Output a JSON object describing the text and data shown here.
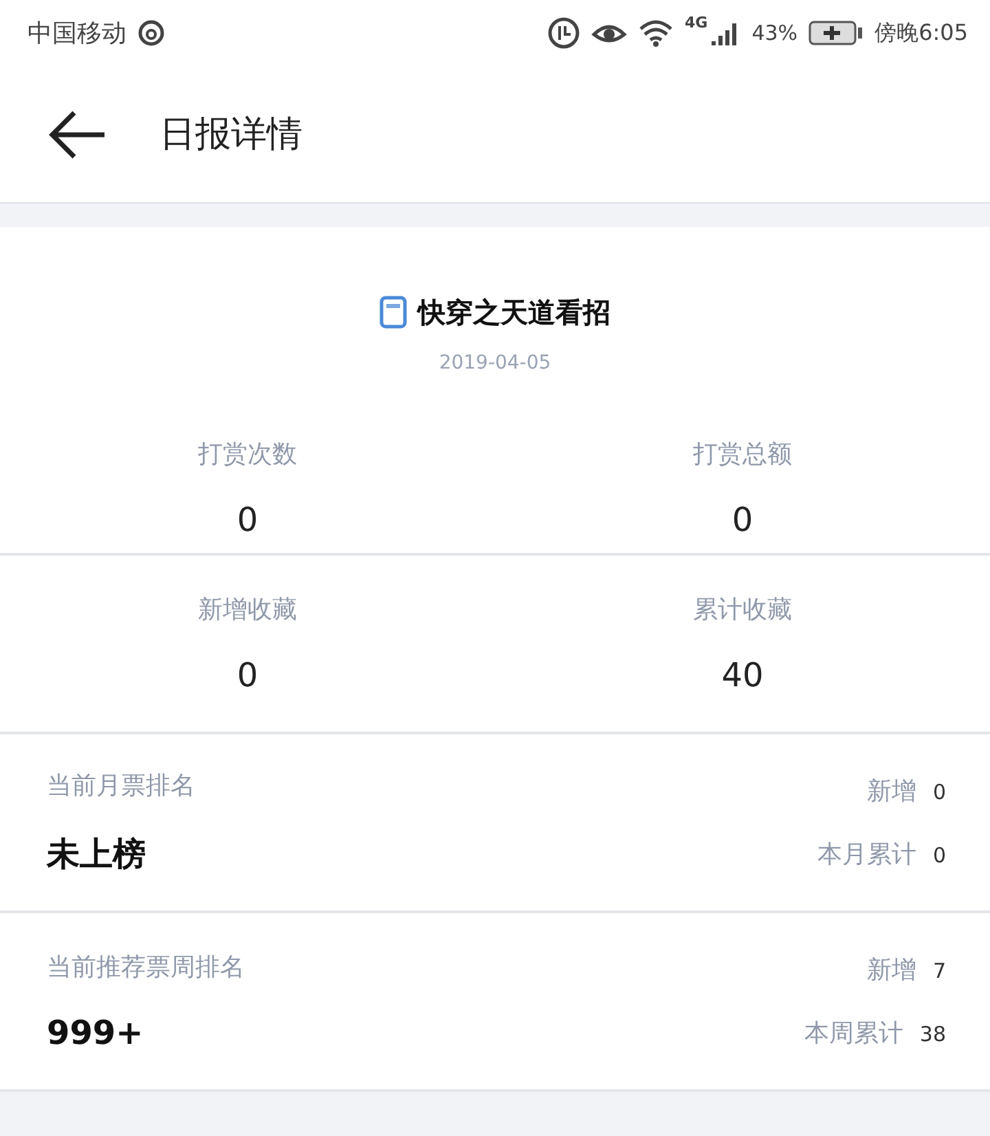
{
  "status_bar": {
    "carrier": "中国移动",
    "network": "4G",
    "battery": "43%",
    "time": "傍晚6:05"
  },
  "header": {
    "title": "日报详情"
  },
  "book": {
    "title": "快穿之天道看招",
    "date": "2019-04-05"
  },
  "stat_rows": [
    {
      "items": [
        {
          "label": "打赏次数",
          "value": "0"
        },
        {
          "label": "打赏总额",
          "value": "0"
        }
      ]
    },
    {
      "items": [
        {
          "label": "新增收藏",
          "value": "0"
        },
        {
          "label": "累计收藏",
          "value": "40"
        }
      ]
    }
  ],
  "rankings": [
    {
      "label": "当前月票排名",
      "rank": "未上榜",
      "new_label": "新增",
      "new_value": "0",
      "total_label": "本月累计",
      "total_value": "0"
    },
    {
      "label": "当前推荐票周排名",
      "rank": "999+",
      "new_label": "新增",
      "new_value": "7",
      "total_label": "本周累计",
      "total_value": "38"
    }
  ]
}
